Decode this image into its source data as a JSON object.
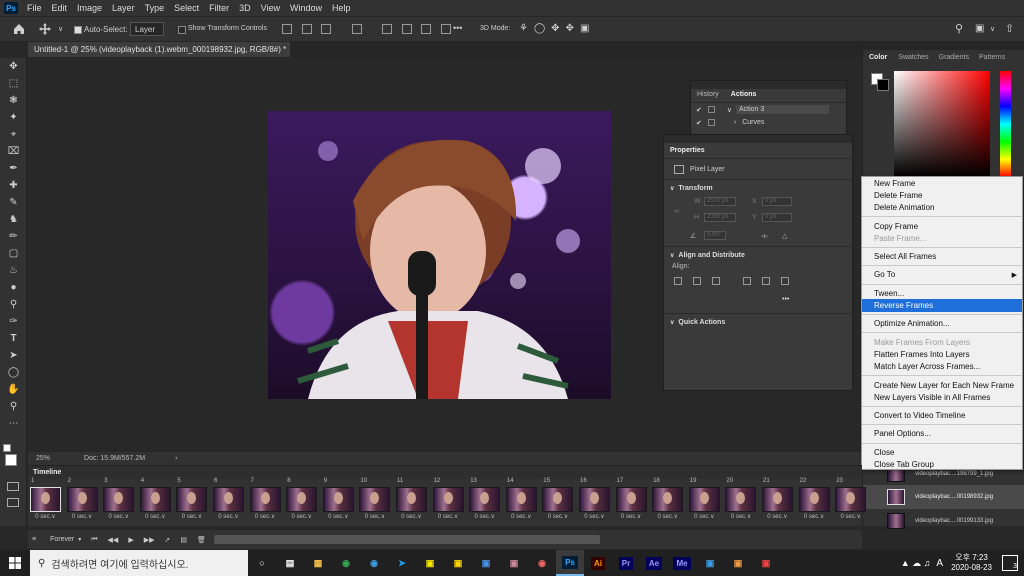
{
  "app": {
    "logo": "Ps"
  },
  "menu": [
    "File",
    "Edit",
    "Image",
    "Layer",
    "Type",
    "Select",
    "Filter",
    "3D",
    "View",
    "Window",
    "Help"
  ],
  "options": {
    "auto_select_label": "Auto-Select:",
    "auto_select_value": "Layer",
    "transform_controls_label": "Show Transform Controls",
    "more": "•••",
    "mode_3d_label": "3D Mode:"
  },
  "document": {
    "tab_title": "Untitled-1 @ 25% (videoplayback (1).webm_000198932.jpg, RGB/8#) *",
    "tab_close": "×"
  },
  "status": {
    "zoom": "25%",
    "doc": "Doc: 15.9M/557.2M",
    "arrow": "›"
  },
  "history_panel": {
    "tabs": [
      "History",
      "Actions"
    ],
    "rows": [
      {
        "check": "✔",
        "label": "Action 3",
        "arrow": "∨"
      },
      {
        "check": "✔",
        "label": "Curves",
        "arrow": "›"
      }
    ]
  },
  "properties": {
    "title": "Properties",
    "kind": "Pixel Layer",
    "transform": {
      "header": "Transform",
      "w_label": "W",
      "w": "2570 px",
      "h_label": "H",
      "h": "2160 px",
      "x_label": "X",
      "x": "0 px",
      "y_label": "Y",
      "y": "0 px",
      "angle": "0.00°"
    },
    "align": {
      "header": "Align and Distribute",
      "label": "Align:",
      "more": "•••"
    },
    "quick_actions": {
      "header": "Quick Actions"
    }
  },
  "right_panel": {
    "tabs": [
      "Color",
      "Swatches",
      "Gradients",
      "Patterns"
    ],
    "layers": [
      {
        "name": "videoplaybac....198799_1.jpg"
      },
      {
        "name": "videoplaybac....00198932.jpg"
      },
      {
        "name": "videoplaybac....00199133.jpg"
      }
    ]
  },
  "context_menu": [
    {
      "label": "New Frame"
    },
    {
      "label": "Delete Frame"
    },
    {
      "label": "Delete Animation"
    },
    {
      "sep": true
    },
    {
      "label": "Copy Frame"
    },
    {
      "label": "Paste Frame...",
      "disabled": true
    },
    {
      "sep": true
    },
    {
      "label": "Select All Frames"
    },
    {
      "sep": true
    },
    {
      "label": "Go To",
      "submenu": "▶"
    },
    {
      "sep": true
    },
    {
      "label": "Tween..."
    },
    {
      "label": "Reverse Frames",
      "selected": true
    },
    {
      "sep": true
    },
    {
      "label": "Optimize Animation..."
    },
    {
      "sep": true
    },
    {
      "label": "Make Frames From Layers",
      "disabled": true
    },
    {
      "label": "Flatten Frames Into Layers"
    },
    {
      "label": "Match Layer Across Frames..."
    },
    {
      "sep": true
    },
    {
      "label": "Create New Layer for Each New Frame"
    },
    {
      "label": "New Layers Visible in All Frames"
    },
    {
      "sep": true
    },
    {
      "label": "Convert to Video Timeline"
    },
    {
      "sep": true
    },
    {
      "label": "Panel Options..."
    },
    {
      "sep": true
    },
    {
      "label": "Close"
    },
    {
      "label": "Close Tab Group"
    }
  ],
  "timeline": {
    "title": "Timeline",
    "loop": "Forever",
    "frame_numbers": [
      "1",
      "2",
      "3",
      "4",
      "5",
      "6",
      "7",
      "8",
      "9",
      "10",
      "11",
      "12",
      "13",
      "14",
      "15",
      "16",
      "17",
      "18",
      "19",
      "20",
      "21",
      "22",
      "23"
    ],
    "frame_duration": "0 sec.∨"
  },
  "taskbar": {
    "search_placeholder": "검색하려면 여기에 입력하십시오.",
    "apps": [
      {
        "label": "Ai",
        "color": "#ff9a00",
        "bg": "#330000"
      },
      {
        "label": "Pr",
        "color": "#9999ff",
        "bg": "#00005b"
      },
      {
        "label": "Ae",
        "color": "#9999ff",
        "bg": "#00005b"
      },
      {
        "label": "Me",
        "color": "#9999ff",
        "bg": "#00005b"
      }
    ],
    "active_app": "Ps",
    "ime": "A",
    "time": "오후 7:23",
    "date": "2020-08-23",
    "notifications": "3"
  },
  "colors": {
    "selection": "#1e6fd9",
    "panel_bg": "#3a3a3a",
    "chrome_bg": "#323232"
  }
}
